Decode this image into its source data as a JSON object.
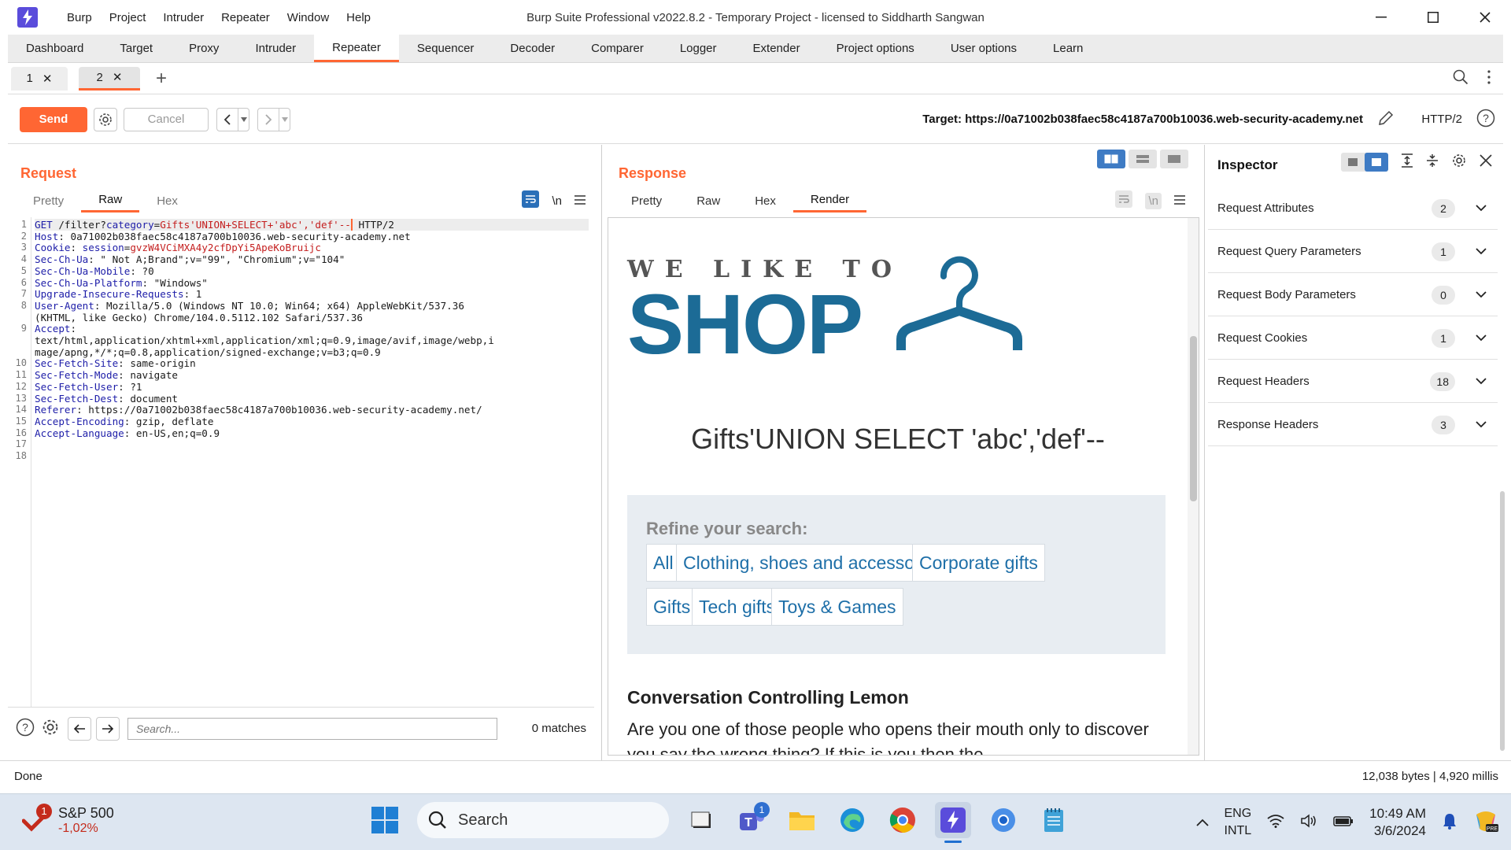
{
  "window": {
    "title": "Burp Suite Professional v2022.8.2 - Temporary Project - licensed to Siddharth Sangwan",
    "menu": [
      "Burp",
      "Project",
      "Intruder",
      "Repeater",
      "Window",
      "Help"
    ]
  },
  "module_tabs": [
    "Dashboard",
    "Target",
    "Proxy",
    "Intruder",
    "Repeater",
    "Sequencer",
    "Decoder",
    "Comparer",
    "Logger",
    "Extender",
    "Project options",
    "User options",
    "Learn"
  ],
  "active_module": "Repeater",
  "repeater_tabs": [
    "1",
    "2"
  ],
  "toolbar": {
    "send_label": "Send",
    "cancel_label": "Cancel",
    "target_text": "Target: https://0a71002b038faec58c4187a700b10036.web-security-academy.net",
    "http_version": "HTTP/2"
  },
  "request": {
    "title": "Request",
    "view_tabs": [
      "Pretty",
      "Raw",
      "Hex"
    ],
    "active_view": "Raw",
    "newline_toggle": "\\n",
    "search_placeholder": "Search...",
    "match_count": "0 matches"
  },
  "response": {
    "title": "Response",
    "view_tabs": [
      "Pretty",
      "Raw",
      "Hex",
      "Render"
    ],
    "active_view": "Render",
    "newline_toggle": "\\n",
    "render": {
      "logo_top": "WE LIKE TO",
      "logo_main": "SHOP",
      "heading": "Gifts'UNION SELECT 'abc','def'--",
      "refine_label": "Refine your search:",
      "categories": [
        "All",
        "Clothing, shoes and accessories",
        "Corporate gifts",
        "Gifts",
        "Tech gifts",
        "Toys & Games"
      ],
      "blog_title": "Conversation Controlling Lemon",
      "blog_text": "Are you one of those people who opens their mouth only to discover you say the wrong thing? If this is you then the"
    }
  },
  "inspector": {
    "title": "Inspector",
    "rows": [
      {
        "label": "Request Attributes",
        "count": "2"
      },
      {
        "label": "Request Query Parameters",
        "count": "1"
      },
      {
        "label": "Request Body Parameters",
        "count": "0"
      },
      {
        "label": "Request Cookies",
        "count": "1"
      },
      {
        "label": "Request Headers",
        "count": "18"
      },
      {
        "label": "Response Headers",
        "count": "3"
      }
    ]
  },
  "status": {
    "left": "Done",
    "right": "12,038 bytes | 4,920 millis"
  },
  "taskbar": {
    "stock_name": "S&P 500",
    "stock_change": "-1,02%",
    "stock_badge": "1",
    "search_label": "Search",
    "teams_badge": "1",
    "lang_line1": "ENG",
    "lang_line2": "INTL",
    "time": "10:49 AM",
    "date": "3/6/2024"
  },
  "colors": {
    "accent": "#ff6633",
    "link": "#1e6fa8",
    "logo": "#1c6b96",
    "burp_purple": "#5a4cdb"
  }
}
